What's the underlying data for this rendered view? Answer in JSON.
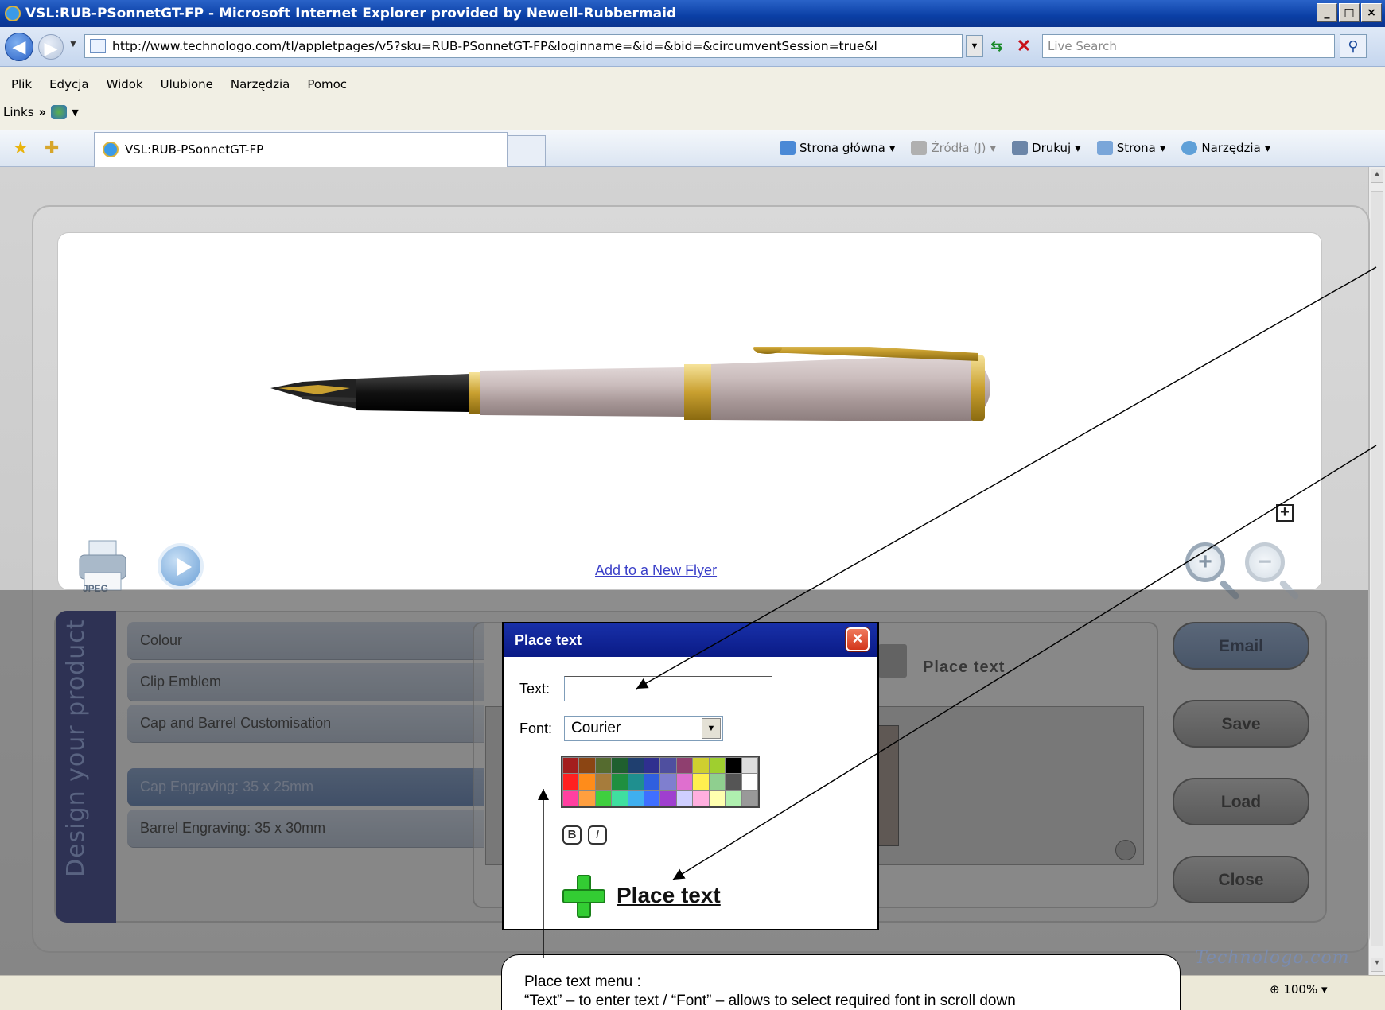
{
  "window": {
    "title": "VSL:RUB-PSonnetGT-FP - Microsoft Internet Explorer provided by Newell-Rubbermaid",
    "controls": [
      "_",
      "□",
      "×"
    ]
  },
  "address": {
    "url": "http://www.technologo.com/tl/appletpages/v5?sku=RUB-PSonnetGT-FP&loginname=&id=&bid=&circumventSession=true&l",
    "search_placeholder": "Live Search"
  },
  "menu": {
    "items": [
      "Plik",
      "Edycja",
      "Widok",
      "Ulubione",
      "Narzędzia",
      "Pomoc"
    ],
    "links_label": "Links",
    "links_chevron": "»"
  },
  "tabs": {
    "active_title": "VSL:RUB-PSonnetGT-FP"
  },
  "commands": {
    "home": "Strona główna",
    "feeds": "Źródła (J)",
    "print": "Drukuj",
    "page": "Strona",
    "tools": "Narzędzia"
  },
  "preview": {
    "print_label": "JPEG",
    "add_flyer": "Add to a New Flyer",
    "zoom_in": "+",
    "zoom_out": "−"
  },
  "design": {
    "vertical_label": "Design your product",
    "menu": [
      {
        "label": "Colour"
      },
      {
        "label": "Clip Emblem"
      },
      {
        "label": "Cap and Barrel Customisation"
      },
      {
        "label": "Cap Engraving: 35 x 25mm"
      },
      {
        "label": "Barrel Engraving: 35 x 30mm"
      }
    ],
    "selected_menu": "Cap Engraving: 35 x 25mm",
    "panel_title": "Place text",
    "buttons": {
      "email": "Email",
      "save": "Save",
      "load": "Load",
      "close": "Close"
    }
  },
  "popup": {
    "title": "Place text",
    "close": "×",
    "text_label": "Text:",
    "text_value": "",
    "font_label": "Font:",
    "font_value": "Courier",
    "bold": "B",
    "italic": "I",
    "place_text": "Place text",
    "palette": [
      "#a31e1e",
      "#8b4513",
      "#556b2f",
      "#1f5f2f",
      "#1f3f6f",
      "#2f2f8f",
      "#4f4f9f",
      "#8f3f6f",
      "#cfcf2f",
      "#9fcf2f",
      "#000000",
      "#dddddd",
      "#ff2020",
      "#ff8c1a",
      "#a67c3c",
      "#1f8f3f",
      "#1f8f8f",
      "#2f5fdf",
      "#7f7fcf",
      "#df6fcf",
      "#ffef4f",
      "#8fcf8f",
      "#555555",
      "#ffffff",
      "#ff3fa0",
      "#ff9f3f",
      "#3fcf3f",
      "#3fdf9f",
      "#3fafef",
      "#3f6fff",
      "#9f3fcf",
      "#cfcfff",
      "#ffafdf",
      "#ffffaf",
      "#afefaf",
      "#999999"
    ]
  },
  "callout": {
    "line1": "Place text menu :",
    "line2": "“Text” – to enter text /  “Font” – allows to select required font in scroll down"
  },
  "brand": {
    "logo_text": "Technologo.com"
  },
  "status": {
    "zoom": "100%"
  }
}
